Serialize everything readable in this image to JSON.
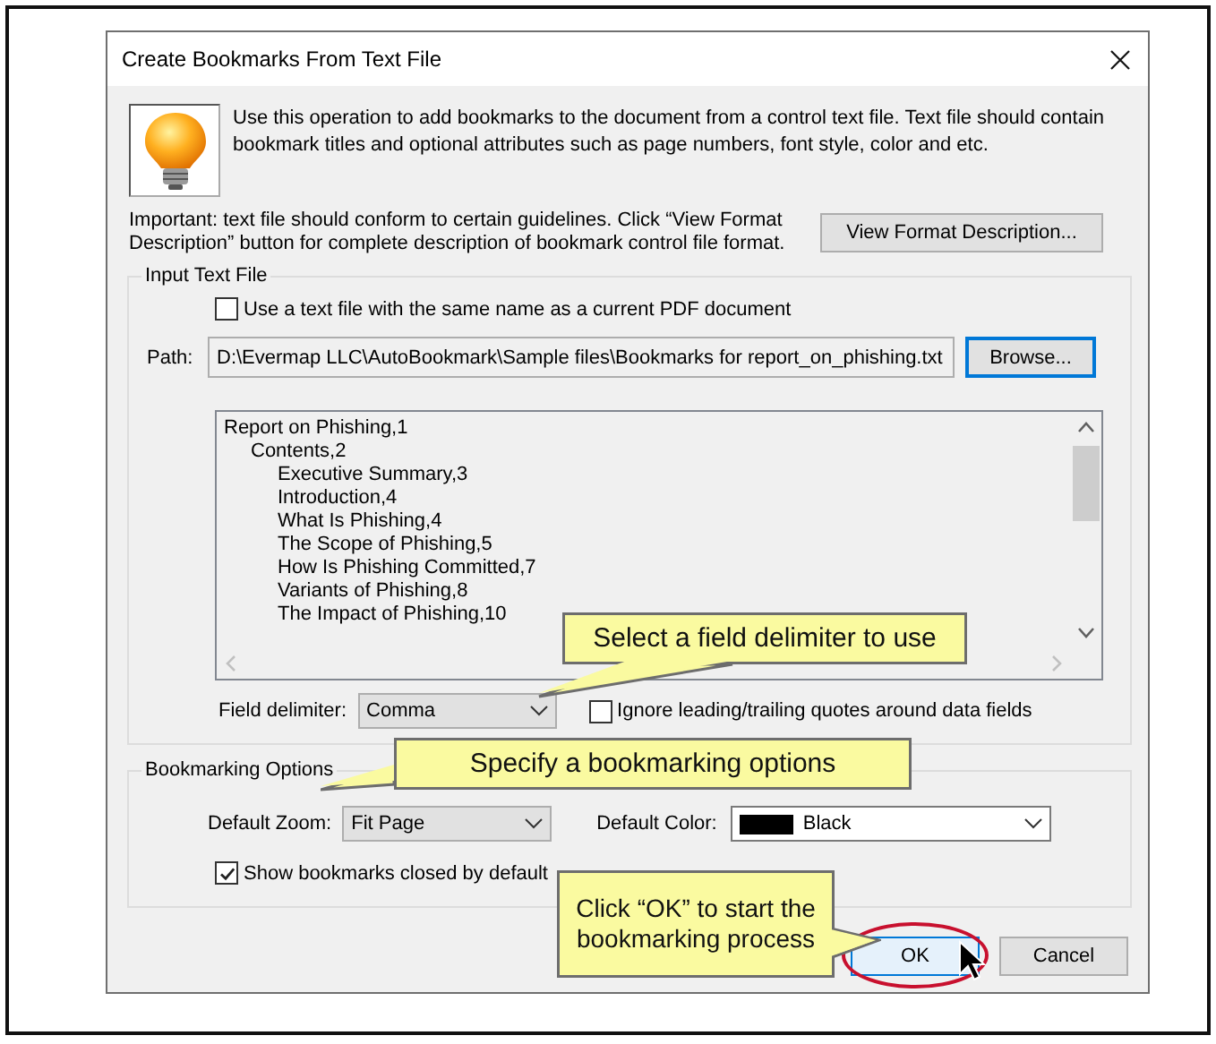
{
  "window": {
    "title": "Create Bookmarks From Text File"
  },
  "intro": {
    "description": "Use this operation to add bookmarks to the document from a control text file. Text file should contain bookmark titles and optional attributes such as page numbers, font style, color and etc.",
    "note": "Important: text file should conform to certain guidelines. Click “View Format Description” button for complete description of bookmark control file format.",
    "format_button": "View Format Description..."
  },
  "input_group": {
    "title": "Input Text File",
    "same_name": {
      "label": "Use a text file with the same name as a current PDF document",
      "checked": false
    },
    "path": {
      "label": "Path:",
      "value": "D:\\Evermap LLC\\AutoBookmark\\Sample files\\Bookmarks for report_on_phishing.txt"
    },
    "browse_button": "Browse...",
    "preview": [
      {
        "text": "Report on Phishing,1",
        "children": [
          {
            "text": "Contents,2",
            "children": [
              {
                "text": "Executive Summary,3"
              },
              {
                "text": "Introduction,4"
              },
              {
                "text": "What Is Phishing,4"
              },
              {
                "text": "The Scope of Phishing,5"
              },
              {
                "text": "How Is Phishing Committed,7"
              },
              {
                "text": "Variants of Phishing,8"
              },
              {
                "text": "The Impact of Phishing,10"
              }
            ]
          }
        ]
      }
    ],
    "field_delimiter": {
      "label": "Field delimiter:",
      "value": "Comma"
    },
    "ignore_quotes": {
      "label": "Ignore leading/trailing quotes around data fields",
      "checked": false
    }
  },
  "options_group": {
    "title": "Bookmarking Options",
    "default_zoom": {
      "label": "Default Zoom:",
      "value": "Fit Page"
    },
    "default_color": {
      "label": "Default Color:",
      "value": "Black",
      "color": "#000000"
    },
    "closed_by_default": {
      "label": "Show bookmarks closed by default",
      "checked": true
    }
  },
  "buttons": [
    {
      "label": "OK",
      "default": true,
      "circled": true
    },
    {
      "label": "Cancel",
      "default": false,
      "circled": false
    }
  ],
  "callouts": [
    {
      "kind": "delimiter",
      "text": "Select a field delimiter to use"
    },
    {
      "kind": "options",
      "text": "Specify a bookmarking options"
    },
    {
      "kind": "ok",
      "text": "Click “OK” to start the bookmarking process"
    }
  ]
}
